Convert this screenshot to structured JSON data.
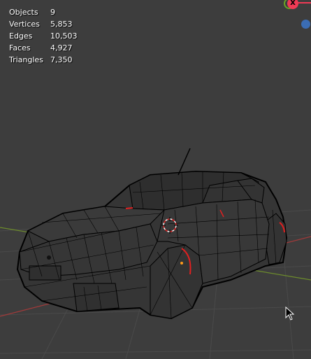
{
  "stats": [
    {
      "label": "Objects",
      "value": "9"
    },
    {
      "label": "Vertices",
      "value": "5,853"
    },
    {
      "label": "Edges",
      "value": "10,503"
    },
    {
      "label": "Faces",
      "value": "4,927"
    },
    {
      "label": "Triangles",
      "value": "7,350"
    }
  ],
  "gizmo": {
    "x_label": "X"
  },
  "colors": {
    "background": "#3d3d3d",
    "grid": "#4a4a4a",
    "axis_x": "#a23a3a",
    "axis_y": "#6d8c2c",
    "wire": "#000000",
    "gizmo_x": "#f03a55",
    "gizmo_y": "#6aa523",
    "gizmo_z": "#3b6db4"
  },
  "icons": [
    "3d-cursor-icon",
    "mouse-pointer-icon",
    "axis-gizmo-icon"
  ]
}
